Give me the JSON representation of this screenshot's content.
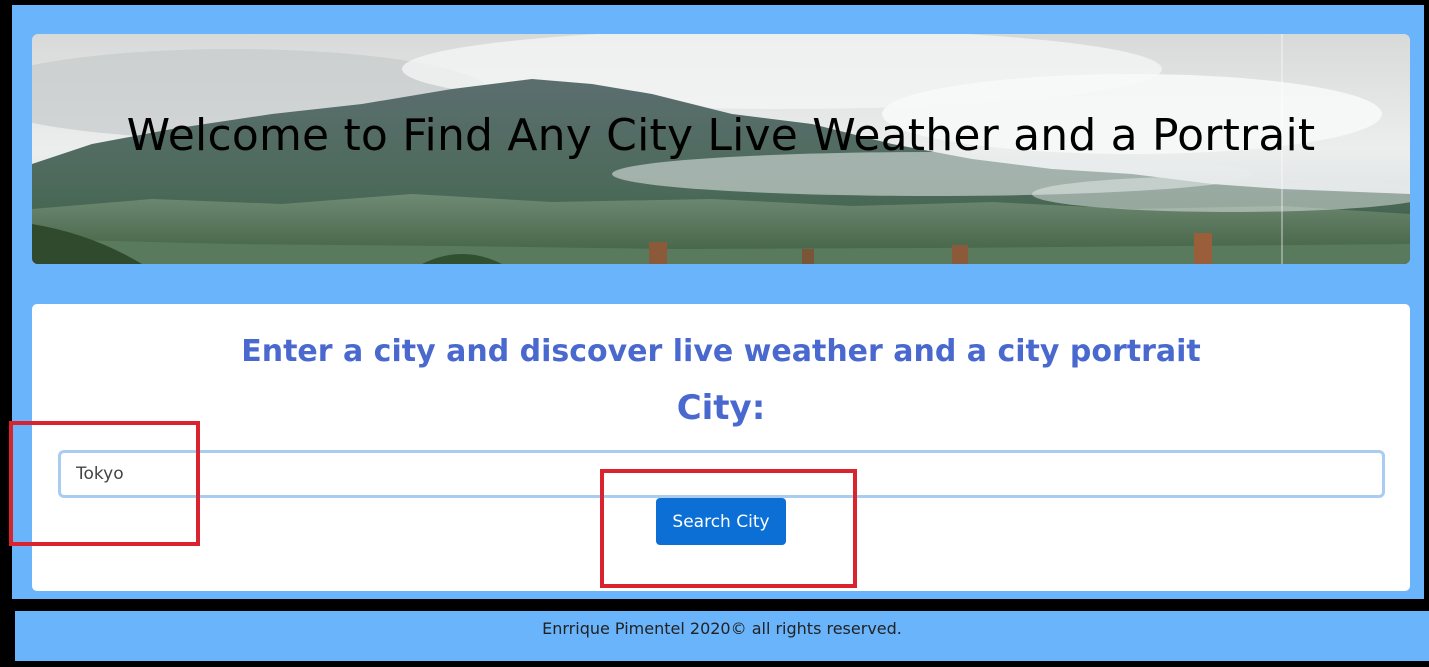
{
  "hero": {
    "title": "Welcome to Find Any City Live Weather and a Portrait",
    "background": "mountain-landscape-image"
  },
  "search_card": {
    "heading": "Enter a city and discover live weather and a city portrait",
    "city_label": "City:",
    "city_input_value": "Tokyo",
    "search_button_label": "Search City"
  },
  "footer": {
    "text": "Enrrique Pimentel 2020© all rights reserved."
  },
  "colors": {
    "page_background": "#69b4fa",
    "heading_color": "#4a69cf",
    "button_color": "#0b6fd6",
    "annotation_color": "#d9232e"
  }
}
